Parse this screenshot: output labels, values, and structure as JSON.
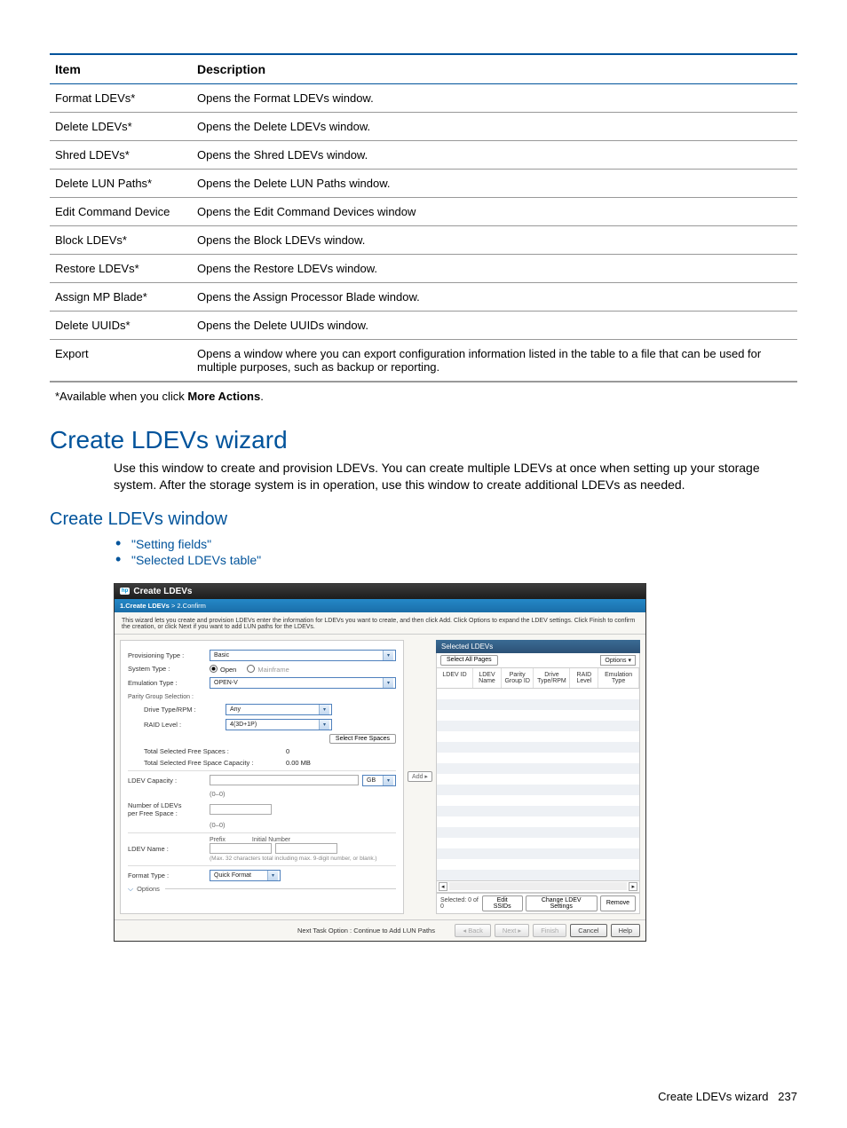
{
  "table": {
    "headers": {
      "item": "Item",
      "description": "Description"
    },
    "rows": [
      {
        "item": "Format LDEVs*",
        "desc": "Opens the Format LDEVs window."
      },
      {
        "item": "Delete LDEVs*",
        "desc": "Opens the Delete LDEVs window."
      },
      {
        "item": "Shred LDEVs*",
        "desc": "Opens the Shred LDEVs window."
      },
      {
        "item": "Delete LUN Paths*",
        "desc": "Opens the Delete LUN Paths window."
      },
      {
        "item": "Edit Command Device",
        "desc": "Opens the Edit Command Devices window"
      },
      {
        "item": "Block LDEVs*",
        "desc": "Opens the Block LDEVs window."
      },
      {
        "item": "Restore LDEVs*",
        "desc": "Opens the Restore LDEVs window."
      },
      {
        "item": "Assign MP Blade*",
        "desc": "Opens the Assign Processor Blade window."
      },
      {
        "item": "Delete UUIDs*",
        "desc": "Opens the Delete UUIDs window."
      },
      {
        "item": "Export",
        "desc": "Opens a window where you can export configuration information listed in the table to a file that can be used for multiple purposes, such as backup or reporting."
      }
    ],
    "footnote_prefix": "*Available when you click ",
    "footnote_bold": "More Actions",
    "footnote_suffix": "."
  },
  "heading": "Create LDEVs wizard",
  "intro": "Use this window to create and provision LDEVs. You can create multiple LDEVs at once when setting up your storage system. After the storage system is in operation, use this window to create additional LDEVs as needed.",
  "subheading": "Create LDEVs window",
  "links": [
    "\"Setting fields\"",
    "\"Selected LDEVs table\""
  ],
  "wizard": {
    "title": "Create LDEVs",
    "breadcrumb_active": "1.Create LDEVs",
    "breadcrumb_rest": "  >  2.Confirm",
    "instructions": "This wizard lets you create and provision LDEVs enter the information for LDEVs you want to create, and then click Add. Click Options to expand the LDEV settings. Click Finish to confirm the creation, or click Next if you want to add LUN paths for the LDEVs.",
    "fields": {
      "provisioning_label": "Provisioning Type :",
      "provisioning_value": "Basic",
      "system_label": "System Type :",
      "system_open": "Open",
      "system_mainframe": "Mainframe",
      "emulation_label": "Emulation Type :",
      "emulation_value": "OPEN-V",
      "pg_label": "Parity Group Selection :",
      "drive_label": "Drive Type/RPM :",
      "drive_value": "Any",
      "raid_label": "RAID Level :",
      "raid_value": "4(3D+1P)",
      "select_spaces_btn": "Select Free Spaces",
      "total_sel_label": "Total Selected Free Spaces :",
      "total_sel_value": "0",
      "total_cap_label": "Total Selected Free Space Capacity :",
      "total_cap_value": "0.00 MB",
      "ldev_cap_label": "LDEV Capacity :",
      "ldev_cap_unit": "GB",
      "ldev_cap_range": "(0–0)",
      "num_label_l1": "Number of LDEVs",
      "num_label_l2": "per Free Space :",
      "num_range": "(0–0)",
      "name_label": "LDEV Name :",
      "name_prefix": "Prefix",
      "name_initial": "Initial Number",
      "name_hint": "(Max. 32 characters total including max. 9-digit number, or blank.)",
      "format_label": "Format Type :",
      "format_value": "Quick Format",
      "options_label": "Options"
    },
    "add_btn": "Add ▸",
    "selected": {
      "title": "Selected LDEVs",
      "select_all": "Select All Pages",
      "options": "Options ▾",
      "cols": {
        "c1": "LDEV ID",
        "c2": "LDEV Name",
        "c3": "Parity Group ID",
        "c4": "Drive Type/RPM",
        "c5": "RAID Level",
        "c6": "Emulation Type"
      },
      "status": "Selected: 0  of  0",
      "edit_ssids": "Edit SSIDs",
      "change_settings": "Change LDEV Settings",
      "remove": "Remove"
    },
    "footer": {
      "next_task": "Next Task Option : Continue to Add LUN Paths",
      "back": "◂ Back",
      "next": "Next ▸",
      "finish": "Finish",
      "cancel": "Cancel",
      "help": "Help"
    }
  },
  "page_footer": {
    "label": "Create LDEVs wizard",
    "num": "237"
  }
}
